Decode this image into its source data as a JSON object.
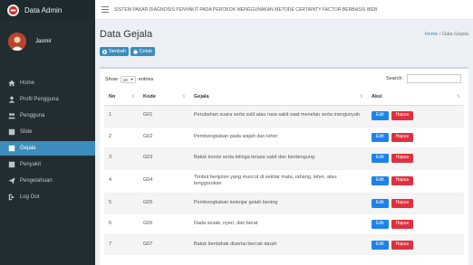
{
  "brand": {
    "name": "Data Admin"
  },
  "user": {
    "name": "Jasmir"
  },
  "topbar": {
    "title": "SISTEM PAKAR DIAGNOSIS PENYAKIT PADA PEROKOK MENGGUNAKAN METODE CERTAINTY FACTOR BERBASIS WEB"
  },
  "menu": [
    {
      "label": "Home",
      "icon": "home-icon"
    },
    {
      "label": "Profil Pengguna",
      "icon": "user-icon"
    },
    {
      "label": "Pengguna",
      "icon": "users-icon"
    },
    {
      "label": "Slide",
      "icon": "slide-icon"
    },
    {
      "label": "Gejala",
      "icon": "list-icon",
      "active": true
    },
    {
      "label": "Penyakit",
      "icon": "list-icon"
    },
    {
      "label": "Pengetahuan",
      "icon": "send-icon"
    },
    {
      "label": "Log Out",
      "icon": "logout-icon"
    }
  ],
  "page": {
    "title": "Data Gejala",
    "breadcrumb_home": "Home",
    "breadcrumb_sep": "/",
    "breadcrumb_current": "Data Gejala"
  },
  "buttons": {
    "tambah": "Tambah",
    "cetak": "Cetak"
  },
  "table_controls": {
    "show": "Show",
    "entries": "entries",
    "select_value": "10",
    "search_label": "Search:"
  },
  "table": {
    "headers": [
      "No",
      "Kode",
      "Gejala",
      "Aksi"
    ],
    "action_edit": "Edit",
    "action_delete": "Hapus",
    "rows": [
      {
        "no": "1",
        "kode": "G01",
        "gejala": "Perubahan suara serta sulit atau rasa sakit saat menelan serta mengunyah"
      },
      {
        "no": "2",
        "kode": "G02",
        "gejala": "Pembengkakan pada wajah dan leher"
      },
      {
        "no": "3",
        "kode": "G03",
        "gejala": "Batuk kronis serta telinga terasa sakit dan berdengung"
      },
      {
        "no": "4",
        "kode": "G04",
        "gejala": "Timbul benjolan yang muncul di sekitar mata, rahang, leher, atau tenggorokan"
      },
      {
        "no": "5",
        "kode": "G05",
        "gejala": "Pembengkakan kelenjar getah bening"
      },
      {
        "no": "6",
        "kode": "G06",
        "gejala": "Dada sesak, nyeri, dan berat"
      },
      {
        "no": "7",
        "kode": "G07",
        "gejala": "Batuk berdahak disertai bercak darah"
      }
    ]
  },
  "colors": {
    "sidebar": "#222d32",
    "accent": "#3c8dbc",
    "edit": "#1e82e8",
    "delete": "#e0303f"
  }
}
